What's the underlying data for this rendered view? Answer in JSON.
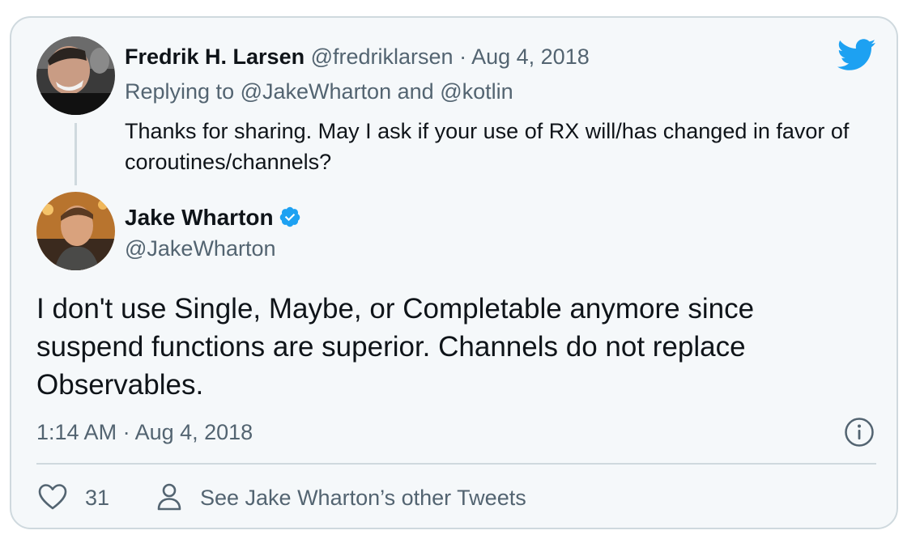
{
  "reply_tweet": {
    "author_name": "Fredrik H. Larsen",
    "handle": "@fredriklarsen",
    "separator": "·",
    "date": "Aug 4, 2018",
    "replying_prefix": "Replying to",
    "replying_user1": "@JakeWharton",
    "replying_conj": "and",
    "replying_user2": "@kotlin",
    "text": "Thanks for sharing. May I ask if your use of RX will/has changed in favor of coroutines/channels?"
  },
  "main_tweet": {
    "author_name": "Jake Wharton",
    "handle": "@JakeWharton",
    "verified": true,
    "text": "I don't use Single, Maybe, or Completable anymore since suspend functions are superior. Channels do not replace Observables.",
    "timestamp": "1:14 AM · Aug 4, 2018"
  },
  "footer": {
    "like_count": "31",
    "other_tweets_label": "See Jake Wharton’s other Tweets"
  },
  "icons": {
    "brand": "twitter-bird-icon",
    "verified": "verified-badge-icon",
    "info": "info-icon",
    "like": "heart-icon",
    "profile": "person-icon"
  },
  "colors": {
    "twitter_blue": "#1da1f2",
    "text": "#0f1419",
    "muted": "#536471",
    "border": "#cfd9de",
    "card_bg": "#f5f8fa"
  }
}
